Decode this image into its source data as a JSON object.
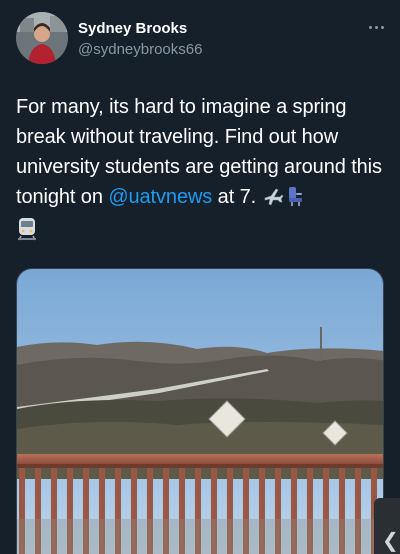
{
  "author": {
    "name": "Sydney Brooks",
    "handle": "@sydneybrooks66"
  },
  "tweet": {
    "text_before": "For many, its hard to imagine a spring break without traveling. Find out how university students are getting around this tonight on ",
    "mention": "@uatvnews",
    "text_after": " at 7. ",
    "emojis": [
      "airplane-icon",
      "seat-icon",
      "train-icon"
    ]
  },
  "media": {
    "alt": "",
    "subject": "hillside-highway-overlook-photo"
  },
  "ui": {
    "more_icon": "more-horizontal-icon",
    "handle_glyph": "❮"
  },
  "colors": {
    "background": "#15202b",
    "text": "#ffffff",
    "secondary": "#8899a6",
    "link": "#1d9bf0"
  }
}
